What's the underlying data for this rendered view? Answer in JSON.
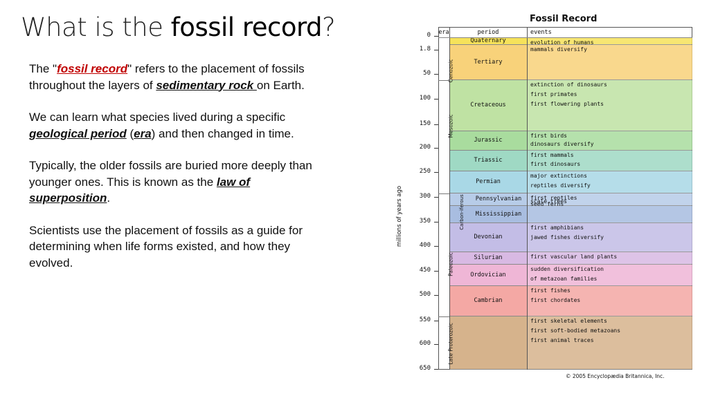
{
  "slide": {
    "title_pre": "What is the ",
    "title_bold": "fossil record",
    "title_post": "?",
    "p1_a": "The \"",
    "p1_link": "fossil record",
    "p1_b": "\" refers to the placement of fossils throughout the layers of ",
    "p1_link2": "sedimentary rock ",
    "p1_c": "on Earth.",
    "p2_a": "We can learn what species lived during a specific ",
    "p2_b1": "geological period",
    "p2_c": " (",
    "p2_b2": "era",
    "p2_d": ") and then changed  in time.",
    "p3_a": "Typically, the older fossils are buried more deeply than younger ones. This is known as the ",
    "p3_b": "law of superposition",
    "p3_c": ".",
    "p4": "Scientists use the placement of fossils as a guide for determining when life forms existed, and how they evolved."
  },
  "chart_data": {
    "type": "table",
    "title": "Fossil Record",
    "ylabel": "millions of years ago",
    "columns": [
      "era",
      "period",
      "events"
    ],
    "y_ticks": [
      "0",
      "1.8",
      "50",
      "100",
      "150",
      "200",
      "250",
      "300",
      "350",
      "400",
      "450",
      "500",
      "550",
      "600",
      "650"
    ],
    "eras": [
      "Cenozoic",
      "Mesozoic",
      "Paleozoic",
      "Late Proterozoic"
    ],
    "carboniferous_label": "Carbon-iferous",
    "periods": [
      {
        "name": "Quaternary",
        "color": "#f6e25a",
        "events": [
          "evolution of humans"
        ]
      },
      {
        "name": "Tertiary",
        "color": "#f8d27a",
        "events": [
          "mammals diversify"
        ]
      },
      {
        "name": "Cretaceous",
        "color": "#bfe2a3",
        "events": [
          "extinction of dinosaurs",
          "first primates",
          "first flowering plants"
        ]
      },
      {
        "name": "Jurassic",
        "color": "#a9dc9e",
        "events": [
          "first birds",
          "dinosaurs diversify"
        ]
      },
      {
        "name": "Triassic",
        "color": "#9fd9c4",
        "events": [
          "first mammals",
          "first dinosaurs"
        ]
      },
      {
        "name": "Permian",
        "color": "#a9d8e6",
        "events": [
          "major extinctions",
          "reptiles diversify"
        ]
      },
      {
        "name": "Pennsylvanian",
        "color": "#b7cce8",
        "events": [
          "first reptiles",
          "scale trees",
          "seed ferns"
        ]
      },
      {
        "name": "Mississippian",
        "color": "#a8bde0",
        "events": []
      },
      {
        "name": "Devonian",
        "color": "#c3bde6",
        "events": [
          "first amphibians",
          "jawed fishes diversify"
        ]
      },
      {
        "name": "Silurian",
        "color": "#d8b9e3",
        "events": [
          "first vascular land plants"
        ]
      },
      {
        "name": "Ordovician",
        "color": "#efb6d6",
        "events": [
          "sudden diversification",
          "of metazoan families"
        ]
      },
      {
        "name": "Cambrian",
        "color": "#f4a8a4",
        "events": [
          "first fishes",
          "first chordates"
        ]
      },
      {
        "name": "",
        "color": "#d6b38c",
        "events": [
          "first skeletal elements",
          "first soft-bodied metazoans",
          "first animal traces"
        ]
      }
    ],
    "copyright": "© 2005 Encyclopædia Britannica, Inc."
  }
}
